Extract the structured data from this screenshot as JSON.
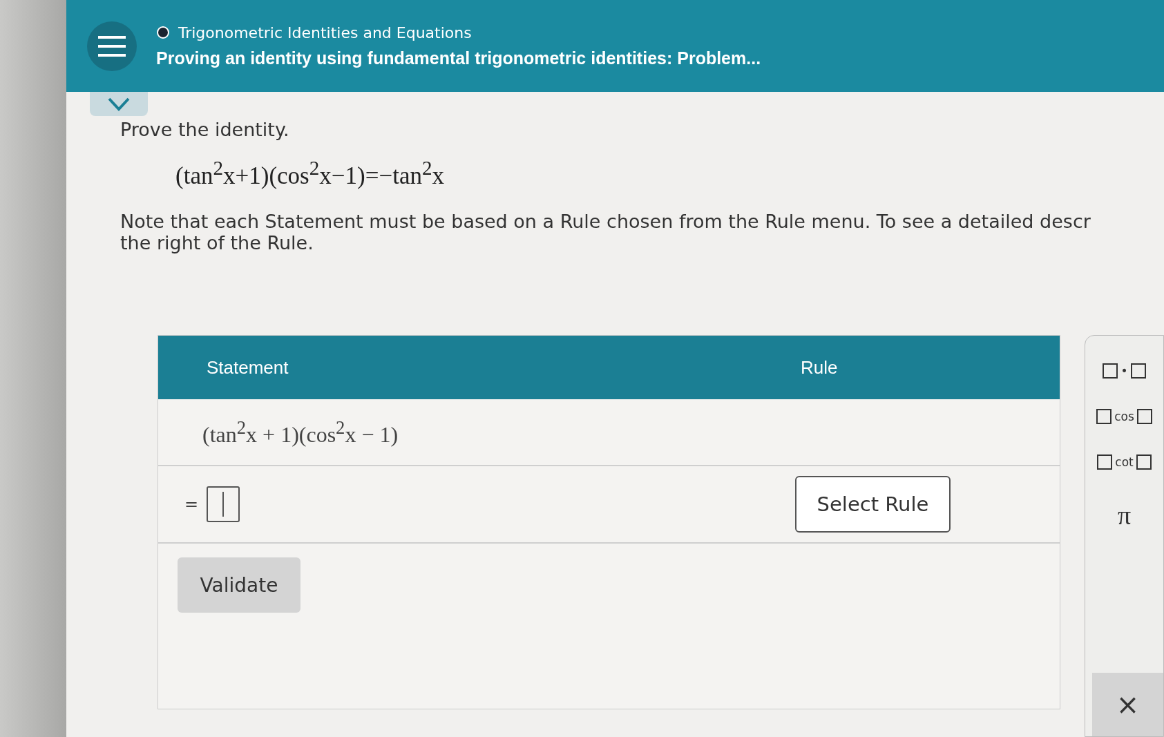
{
  "header": {
    "topic": "Trigonometric Identities and Equations",
    "title": "Proving an identity using fundamental trigonometric identities: Problem..."
  },
  "problem": {
    "prompt": "Prove the identity.",
    "identity": "(tan$^{2}$x+1)(cos$^{2}$x−1)=−tan$^{2}$x",
    "note": "Note that each Statement must be based on a Rule chosen from the Rule menu. To see a detailed descr",
    "note_line2": "the right of the Rule."
  },
  "table": {
    "columns": [
      "Statement",
      "Rule"
    ],
    "rows": [
      {
        "kind": "expression",
        "statement": "(tan$^{2}$x + 1)(cos$^{2}$x − 1)"
      },
      {
        "kind": "input",
        "prefix": "=",
        "rule_button": "Select Rule"
      }
    ],
    "validate": "Validate"
  },
  "palette": {
    "keys": [
      {
        "kind": "binary",
        "symbol": "•"
      },
      {
        "kind": "binary",
        "symbol": "cos"
      },
      {
        "kind": "binary",
        "symbol": "cot"
      },
      {
        "kind": "single",
        "symbol": "π"
      }
    ],
    "close": "×"
  }
}
